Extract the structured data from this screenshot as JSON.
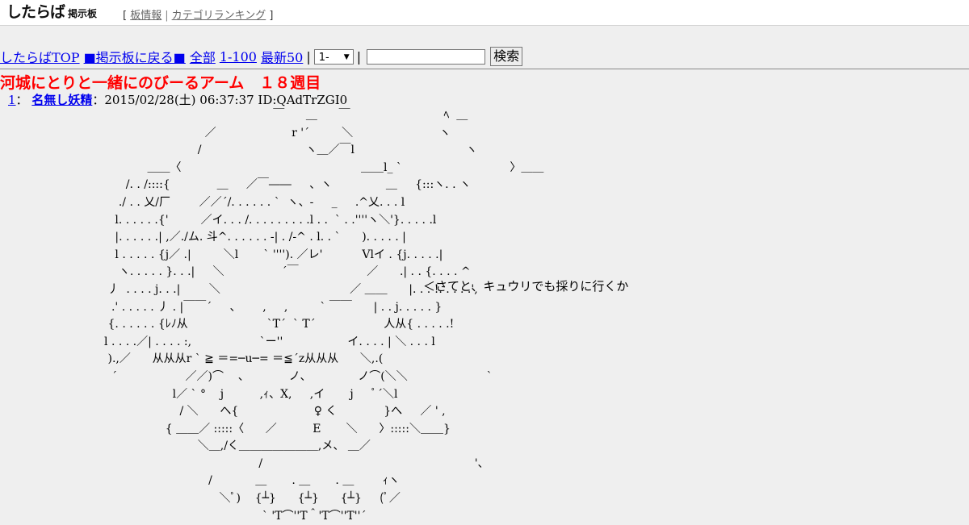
{
  "header": {
    "logo_main": "したらば",
    "logo_sub": "掲示板",
    "links": [
      "板情報",
      "カテゴリランキング"
    ],
    "bracket_open": "[",
    "bracket_close": "]",
    "separator": "|"
  },
  "nav": {
    "top": "したらばTOP",
    "back": "■掲示板に戻る■",
    "all": "全部",
    "range": "1-100",
    "latest": "最新50",
    "sep": "|",
    "select_value": "1-",
    "search_value": "",
    "search_button": "検索"
  },
  "thread": {
    "title": "河城にとりと一緒にのびーるアーム　１８週目"
  },
  "post": {
    "number": "1",
    "colon": "：",
    "name": "名無し妖精",
    "meta": "：2015/02/28(土) 06:37:37 ID:QAdTrZGI0",
    "speech": "＜さてと、キュウリでも採りに行くか",
    "aa_lines": [
      "                                                                            ￣      ＿      ￣                          ﾍ  ＿",
      "                                                         ／                     r '´         ＼                        ヽ",
      "                                                       /                             ヽ＿／￣l                               ヽ",
      "                                         ＿＿〈                                                  ＿＿l_ `                              〉＿＿",
      "                                   /. . /::::{             ＿     ／￣――     、ヽ               ＿     {:::ヽ. . ヽ",
      "                                 ./ . . 乂/厂        ／／´/. . . . . . `  ヽ、-     _     .^乂. . . l",
      "                                l. . . . . .{'         ／イ. . . /. . . . . . . . .l . .  ` . .''''ヽ＼'}. . . . .l",
      "                                |. . . . . .| ,／./ム. 斗^. . . . . . -| . /-^ . l. . `      ). . . . . |",
      "                                l . . . . . {j／ .|         ＼l       ` ''''). ／レ'           Vlイ . {j. . . . .|",
      "                                 ヽ. . . . . }. . .|     ＼                ´￣                   ／      .| . . {. . . . ^",
      "                              丿  . . . . j. . .|        ＼                                    ／ ＿＿      |. . . !. . . . .',",
      "                               .' . . . . . 丿 . |￣￣´     、      ,     ,         ` ￣￣      | . . j. . . . . }",
      "                              {. . . . . . {ﾚﾉ从                      `T´  ` T´                   人从{ . . . . .!",
      "                             l . . . .／| . . . . :,                   `ー''                  イ. . . . | ＼ . . . l",
      "                              ).,／      从从从r ` ≧ ＝=─u─= ＝≦´z从从从      ＼,.(",
      "                               ´                   ／／)⌒    、           ノ、             ノ⌒(＼＼                      `",
      "                                                l／ ` °    j          ,ｨ、X,     ,イ       j     ﾟ´＼l",
      "                                                  / ＼      へ{                     ♀ く             }へ     ／ ' ,",
      "                                              { ＿＿／ :::::〈      ／          E       ＼      〉:::::＼＿＿}",
      "                                                       ＼＿,/く＿＿＿＿＿＿＿,メ、 ＿／",
      "                                                                        /                                                           '、",
      "                                                          /            ＿       . ＿       . ＿        ｨヽ",
      "                                                             ＼ﾟ)    {┴}      {┴}      {┴}     (ﾟ／",
      "                                                                         ` 'T⌒''T＾'T⌒''T''´"
    ]
  }
}
